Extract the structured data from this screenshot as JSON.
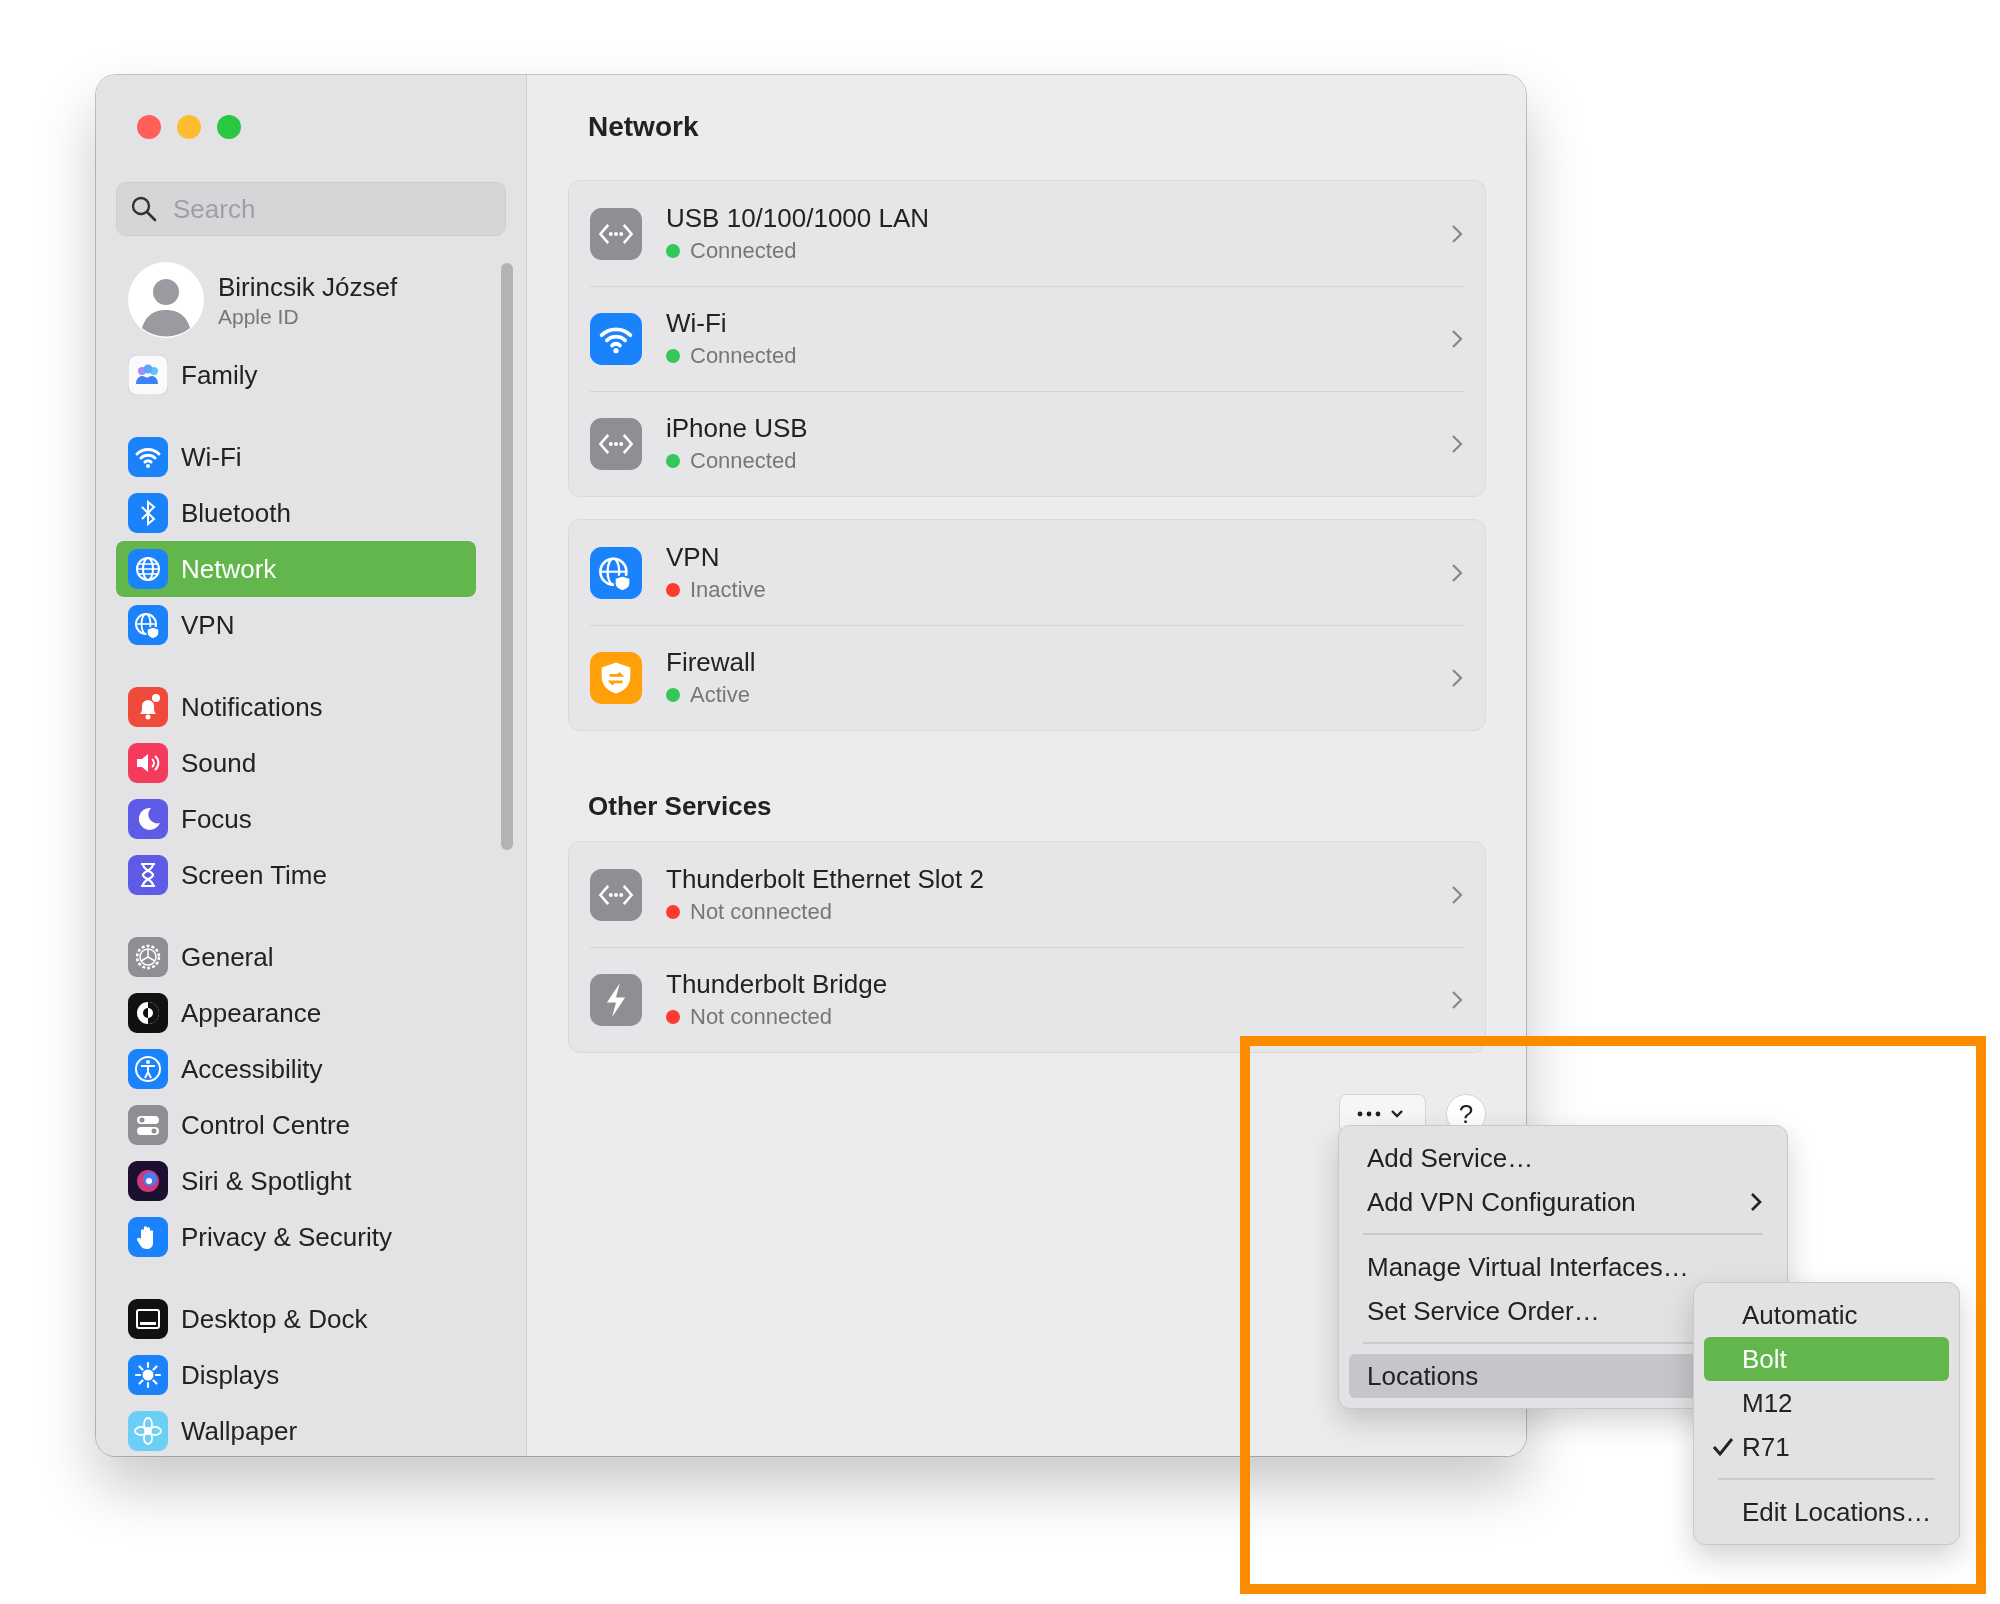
{
  "window": {
    "controls": [
      {
        "color": "#ff5f57"
      },
      {
        "color": "#febc2e"
      },
      {
        "color": "#28c840"
      }
    ]
  },
  "sidebar": {
    "search": {
      "placeholder": "Search"
    },
    "profile": {
      "name": "Birincsik József",
      "subtitle": "Apple ID"
    },
    "groups": [
      {
        "items": [
          {
            "label": "Family",
            "kind": "family",
            "selected": false
          }
        ]
      },
      {
        "items": [
          {
            "label": "Wi-Fi",
            "kind": "wifi",
            "selected": false
          },
          {
            "label": "Bluetooth",
            "kind": "bluetooth",
            "selected": false
          },
          {
            "label": "Network",
            "kind": "network",
            "selected": true
          },
          {
            "label": "VPN",
            "kind": "vpn",
            "selected": false
          }
        ]
      },
      {
        "items": [
          {
            "label": "Notifications",
            "kind": "notifications",
            "selected": false
          },
          {
            "label": "Sound",
            "kind": "sound",
            "selected": false
          },
          {
            "label": "Focus",
            "kind": "focus",
            "selected": false
          },
          {
            "label": "Screen Time",
            "kind": "screentime",
            "selected": false
          }
        ]
      },
      {
        "items": [
          {
            "label": "General",
            "kind": "general",
            "selected": false
          },
          {
            "label": "Appearance",
            "kind": "appearance",
            "selected": false
          },
          {
            "label": "Accessibility",
            "kind": "accessibility",
            "selected": false
          },
          {
            "label": "Control Centre",
            "kind": "controlcentre",
            "selected": false
          },
          {
            "label": "Siri & Spotlight",
            "kind": "siri",
            "selected": false
          },
          {
            "label": "Privacy & Security",
            "kind": "privacy",
            "selected": false
          }
        ]
      },
      {
        "items": [
          {
            "label": "Desktop & Dock",
            "kind": "desktop",
            "selected": false
          },
          {
            "label": "Displays",
            "kind": "displays",
            "selected": false
          },
          {
            "label": "Wallpaper",
            "kind": "wallpaper",
            "selected": false
          }
        ]
      }
    ]
  },
  "main": {
    "title": "Network",
    "sections": [
      {
        "services": [
          {
            "name": "USB 10/100/1000 LAN",
            "status": "Connected",
            "color": "#34c759",
            "kind": "ethernet"
          },
          {
            "name": "Wi-Fi",
            "status": "Connected",
            "color": "#34c759",
            "kind": "wifi"
          },
          {
            "name": "iPhone USB",
            "status": "Connected",
            "color": "#34c759",
            "kind": "ethernet"
          }
        ]
      },
      {
        "services": [
          {
            "name": "VPN",
            "status": "Inactive",
            "color": "#ff3b30",
            "kind": "vpn"
          },
          {
            "name": "Firewall",
            "status": "Active",
            "color": "#34c759",
            "kind": "firewall"
          }
        ]
      },
      {
        "heading": "Other Services",
        "services": [
          {
            "name": "Thunderbolt Ethernet Slot 2",
            "status": "Not connected",
            "color": "#ff3b30",
            "kind": "ethernet"
          },
          {
            "name": "Thunderbolt Bridge",
            "status": "Not connected",
            "color": "#ff3b30",
            "kind": "thunderbolt"
          }
        ]
      }
    ],
    "help_button": {
      "label": "?"
    }
  },
  "menu": {
    "groups": [
      {
        "items": [
          {
            "label": "Add Service…",
            "submenu": false,
            "selected": false
          },
          {
            "label": "Add VPN Configuration",
            "submenu": true,
            "selected": false
          }
        ]
      },
      {
        "items": [
          {
            "label": "Manage Virtual Interfaces…",
            "submenu": false,
            "selected": false
          },
          {
            "label": "Set Service Order…",
            "submenu": false,
            "selected": false
          }
        ]
      },
      {
        "items": [
          {
            "label": "Locations",
            "submenu": false,
            "selected": true
          }
        ]
      }
    ]
  },
  "submenu": {
    "groups": [
      {
        "items": [
          {
            "label": "Automatic",
            "selected": false,
            "checked": false
          },
          {
            "label": "Bolt",
            "selected": true,
            "checked": false
          },
          {
            "label": "M12",
            "selected": false,
            "checked": false
          },
          {
            "label": "R71",
            "selected": false,
            "checked": true
          }
        ]
      },
      {
        "items": [
          {
            "label": "Edit Locations…",
            "selected": false,
            "checked": false
          }
        ]
      }
    ]
  }
}
